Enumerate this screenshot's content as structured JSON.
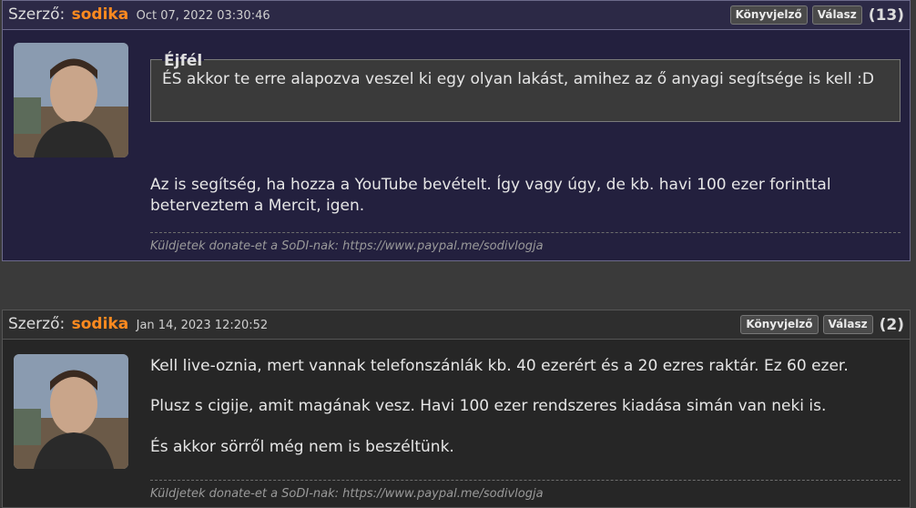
{
  "posts": [
    {
      "author_label": "Szerző:",
      "author_name": "sodika",
      "date": "Oct 07, 2022 03:30:46",
      "bookmark_label": "Könyvjelző",
      "reply_label": "Válasz",
      "reply_count": "(13)",
      "quote": {
        "title": "Éjfél",
        "text": "ÉS akkor te erre alapozva veszel ki egy olyan lakást, amihez az ő anyagi segítsége is kell :D"
      },
      "paragraphs": [
        "Az is segítség, ha hozza a YouTube bevételt. Így vagy úgy, de kb. havi 100 ezer forinttal beterveztem a Mercit, igen."
      ],
      "signature": "Küldjetek donate-et a SoDI-nak: https://www.paypal.me/sodivlogja"
    },
    {
      "author_label": "Szerző:",
      "author_name": "sodika",
      "date": "Jan 14, 2023 12:20:52",
      "bookmark_label": "Könyvjelző",
      "reply_label": "Válasz",
      "reply_count": "(2)",
      "paragraphs": [
        "Kell live-oznia, mert vannak telefonszánlák kb. 40 ezerért és a 20 ezres raktár. Ez 60 ezer.",
        "Plusz s cigije, amit magának vesz. Havi 100 ezer rendszeres kiadása simán van neki is.",
        "És akkor sörről még nem is beszéltünk."
      ],
      "signature": "Küldjetek donate-et a SoDI-nak: https://www.paypal.me/sodivlogja"
    }
  ]
}
